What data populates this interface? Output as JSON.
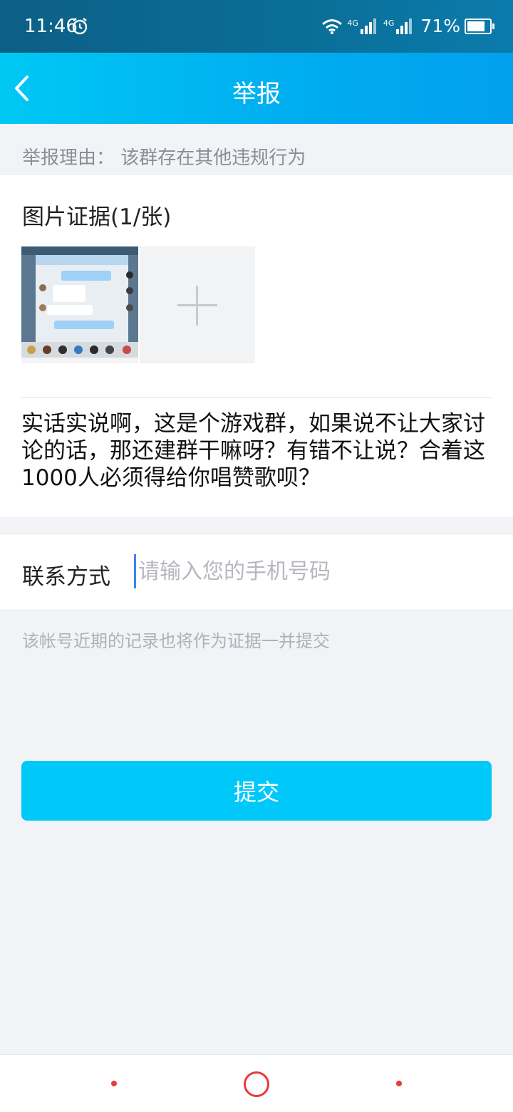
{
  "status_bar": {
    "time": "11:46",
    "network1": "4G",
    "network2": "4G",
    "battery": "71%"
  },
  "header": {
    "title": "举报"
  },
  "reason": {
    "text": "举报理由： 该群存在其他违规行为"
  },
  "evidence": {
    "title": "图片证据(1/张)",
    "description": "实话实说啊，这是个游戏群，如果说不让大家讨论的话，那还建群干嘛呀？有错不让说？合着这1000人必须得给你唱赞歌呗？"
  },
  "contact": {
    "label": "联系方式",
    "value": "",
    "placeholder": "请输入您的手机号码"
  },
  "note": {
    "text": "该帐号近期的记录也将作为证据一并提交"
  },
  "submit": {
    "label": "提交"
  },
  "colors": {
    "header_start": "#00c8f4",
    "header_end": "#02a0ee",
    "submit": "#00c9fa",
    "nav_accent": "#e83a3a"
  }
}
